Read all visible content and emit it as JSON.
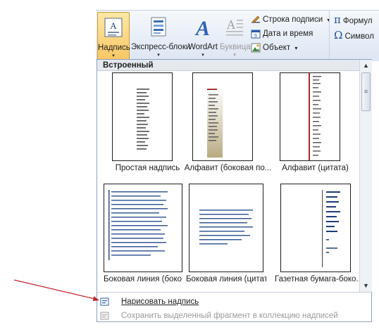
{
  "ribbon": {
    "buttons": [
      {
        "label": "Надпись",
        "arrow": "▾"
      },
      {
        "label": "Экспресс-блоки",
        "arrow": "▾"
      },
      {
        "label": "WordArt",
        "arrow": "▾"
      },
      {
        "label": "Буквица",
        "arrow": "▾"
      }
    ],
    "small": [
      {
        "label": "Строка подписи",
        "arrow": "▾"
      },
      {
        "label": "Дата и время"
      },
      {
        "label": "Объект",
        "arrow": "▾"
      },
      {
        "label": "Формул"
      },
      {
        "label": "Символ"
      }
    ]
  },
  "gallery": {
    "section": "Встроенный",
    "items": [
      {
        "caption": "Простая надпись"
      },
      {
        "caption": "Алфавит (боковая по..."
      },
      {
        "caption": "Алфавит (цитата)"
      },
      {
        "caption": "Боковая линия (боко..."
      },
      {
        "caption": "Боковая линия (цитата)"
      },
      {
        "caption": "Газетная бумага-боко..."
      }
    ]
  },
  "menu": {
    "draw": "Нарисовать надпись",
    "save": "Сохранить выделенный фрагмент в коллекцию надписей"
  },
  "scrollbar": {
    "up": "▲",
    "down": "▼",
    "middle": "≡"
  },
  "colors": {
    "accent": "#f8c765",
    "pointer": "#c0262c",
    "panel_border": "#8da2bf"
  }
}
